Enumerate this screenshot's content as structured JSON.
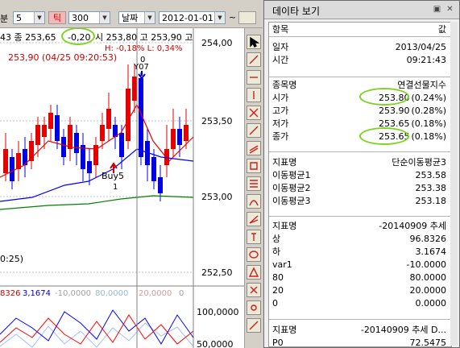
{
  "toolbar": {
    "unit_suffix": "분",
    "period_value": "5",
    "tick_button": "틱",
    "tick_value": "300",
    "date_button": "날짜",
    "date_value": "2012-01-01",
    "tilde": "~",
    "combo_arrow": "▼"
  },
  "chart": {
    "price_labels": [
      "254,00",
      "253,50",
      "253,00",
      "252,50"
    ],
    "osc_labels": [
      "100,0000",
      "50,0000"
    ],
    "info_line1_a": "43  종 253,65",
    "info_line1_change": "-0,20",
    "info_line1_b": "시 253,80 고 253,90 고",
    "info_line2": "H: -0,18%   L: 0,34%",
    "info_line3": "253,90 (04/25 09:20:53)",
    "marker_0": "0",
    "marker_y07": "Y07",
    "buy_label": "Buy5",
    "buy_sub": "1",
    "time_label": "0:25)",
    "osc_legend_a": "8326",
    "osc_legend_b": "3,1674",
    "osc_legend_c": "-10,0000",
    "osc_legend_d": "80,0000",
    "osc_legend_e": "20,0000",
    "osc_legend_f": "0",
    "colors": {
      "up": "#e60000",
      "down": "#0000e6",
      "ma1": "#e60000",
      "ma2": "#0000ff",
      "ma3": "#008000",
      "osc_blue": "#0000ff",
      "osc_red": "#ff0000",
      "grid": "#c0c0c0"
    }
  },
  "data_window": {
    "title": "데이타 보기",
    "close_glyph": "✕",
    "pin_glyph": "▣",
    "header": {
      "item": "항목",
      "value": "값"
    },
    "group1": [
      {
        "k": "일자",
        "v": "2013/04/25"
      },
      {
        "k": "시간",
        "v": "09:21:43"
      }
    ],
    "group2": [
      {
        "k": "종목명",
        "v": "연결선물지수"
      },
      {
        "k": "시가",
        "v": "253.80",
        "pct": "(0.24%)"
      },
      {
        "k": "고가",
        "v": "253.90",
        "pct": "(0.28%)"
      },
      {
        "k": "저가",
        "v": "253.65",
        "pct": "(0.18%)"
      },
      {
        "k": "종가",
        "v": "253.65",
        "pct": "(0.18%)"
      }
    ],
    "group3": [
      {
        "k": "지표명",
        "v": "단순이동평균3"
      },
      {
        "k": "이동평균1",
        "v": "253.58"
      },
      {
        "k": "이동평균2",
        "v": "253.38"
      },
      {
        "k": "이동평균3",
        "v": "253.18"
      }
    ],
    "group4": [
      {
        "k": "지표명",
        "v": "-20140909 추세"
      },
      {
        "k": "상",
        "v": "96.8326"
      },
      {
        "k": "하",
        "v": "3.1674"
      },
      {
        "k": "var1",
        "v": "-10.0000"
      },
      {
        "k": "80",
        "v": "80.0000"
      },
      {
        "k": "20",
        "v": "20.0000"
      },
      {
        "k": "0",
        "v": "0.0000"
      }
    ],
    "group5": [
      {
        "k": "지표명",
        "v": "-20140909 추세 D..."
      },
      {
        "k": "P0",
        "v": "72.5475"
      }
    ]
  }
}
